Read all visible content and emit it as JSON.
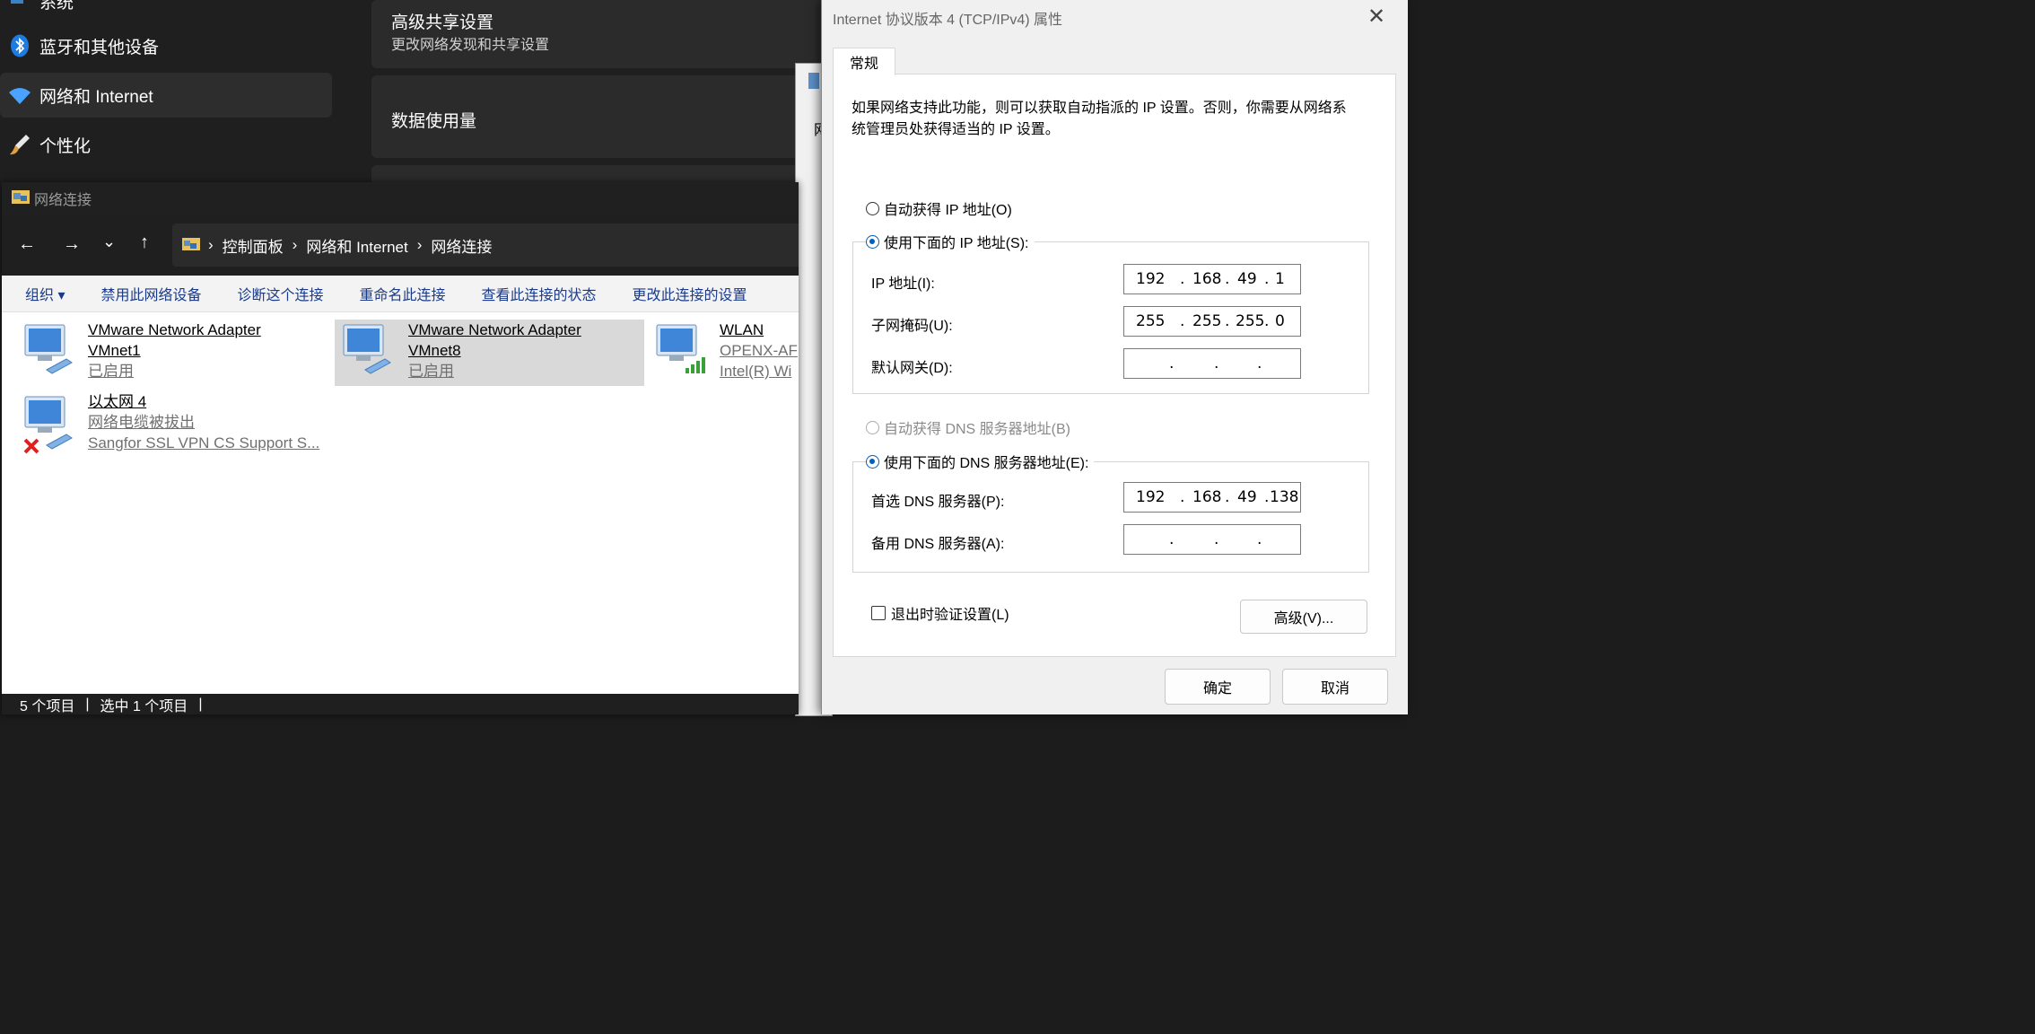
{
  "settings": {
    "nav_top_partial": "系统",
    "nav": [
      {
        "label": "蓝牙和其他设备",
        "icon": "bluetooth-icon"
      },
      {
        "label": "网络和 Internet",
        "icon": "wifi-icon"
      },
      {
        "label": "个性化",
        "icon": "brush-icon"
      }
    ],
    "cards": [
      {
        "title": "高级共享设置",
        "subtitle": "更改网络发现和共享设置"
      },
      {
        "title": "数据使用量"
      }
    ]
  },
  "explorer": {
    "title": "网络连接",
    "breadcrumb": [
      "控制面板",
      "网络和 Internet",
      "网络连接"
    ],
    "commands": [
      "组织 ▾",
      "禁用此网络设备",
      "诊断这个连接",
      "重命名此连接",
      "查看此连接的状态",
      "更改此连接的设置"
    ],
    "items": [
      {
        "name1": "VMware Network Adapter",
        "name2": "VMnet1",
        "status": "已启用",
        "selected": false
      },
      {
        "name1": "VMware Network Adapter",
        "name2": "VMnet8",
        "status": "已启用",
        "selected": true
      },
      {
        "name1": "WLAN",
        "line2": "OPENX-AF",
        "line3": "Intel(R) Wi"
      },
      {
        "name1": "以太网 4",
        "line2": "网络电缆被拔出",
        "line3": "Sangfor SSL VPN CS Support S..."
      }
    ],
    "status_bar": {
      "count": "5 个项目",
      "selected": "选中 1 个项目"
    }
  },
  "dialog": {
    "title": "Internet 协议版本 4 (TCP/IPv4) 属性",
    "tab": "常规",
    "description": "如果网络支持此功能，则可以获取自动指派的 IP 设置。否则，你需要从网络系统管理员处获得适当的 IP 设置。",
    "radio_auto_ip": "自动获得 IP 地址(O)",
    "radio_manual_ip": "使用下面的 IP 地址(S):",
    "ip_label": "IP 地址(I):",
    "ip": [
      "192",
      "168",
      "49",
      "1"
    ],
    "mask_label": "子网掩码(U):",
    "mask": [
      "255",
      "255",
      "255",
      "0"
    ],
    "gateway_label": "默认网关(D):",
    "radio_auto_dns": "自动获得 DNS 服务器地址(B)",
    "radio_manual_dns": "使用下面的 DNS 服务器地址(E):",
    "dns1_label": "首选 DNS 服务器(P):",
    "dns1": [
      "192",
      "168",
      "49",
      "138"
    ],
    "dns2_label": "备用 DNS 服务器(A):",
    "validate_label": "退出时验证设置(L)",
    "advanced": "高级(V)...",
    "ok": "确定",
    "cancel": "取消"
  },
  "colors": {
    "accent": "#005fb8",
    "dark_bg": "#1f1f1f",
    "dialog_bg": "#f0f0f0"
  }
}
